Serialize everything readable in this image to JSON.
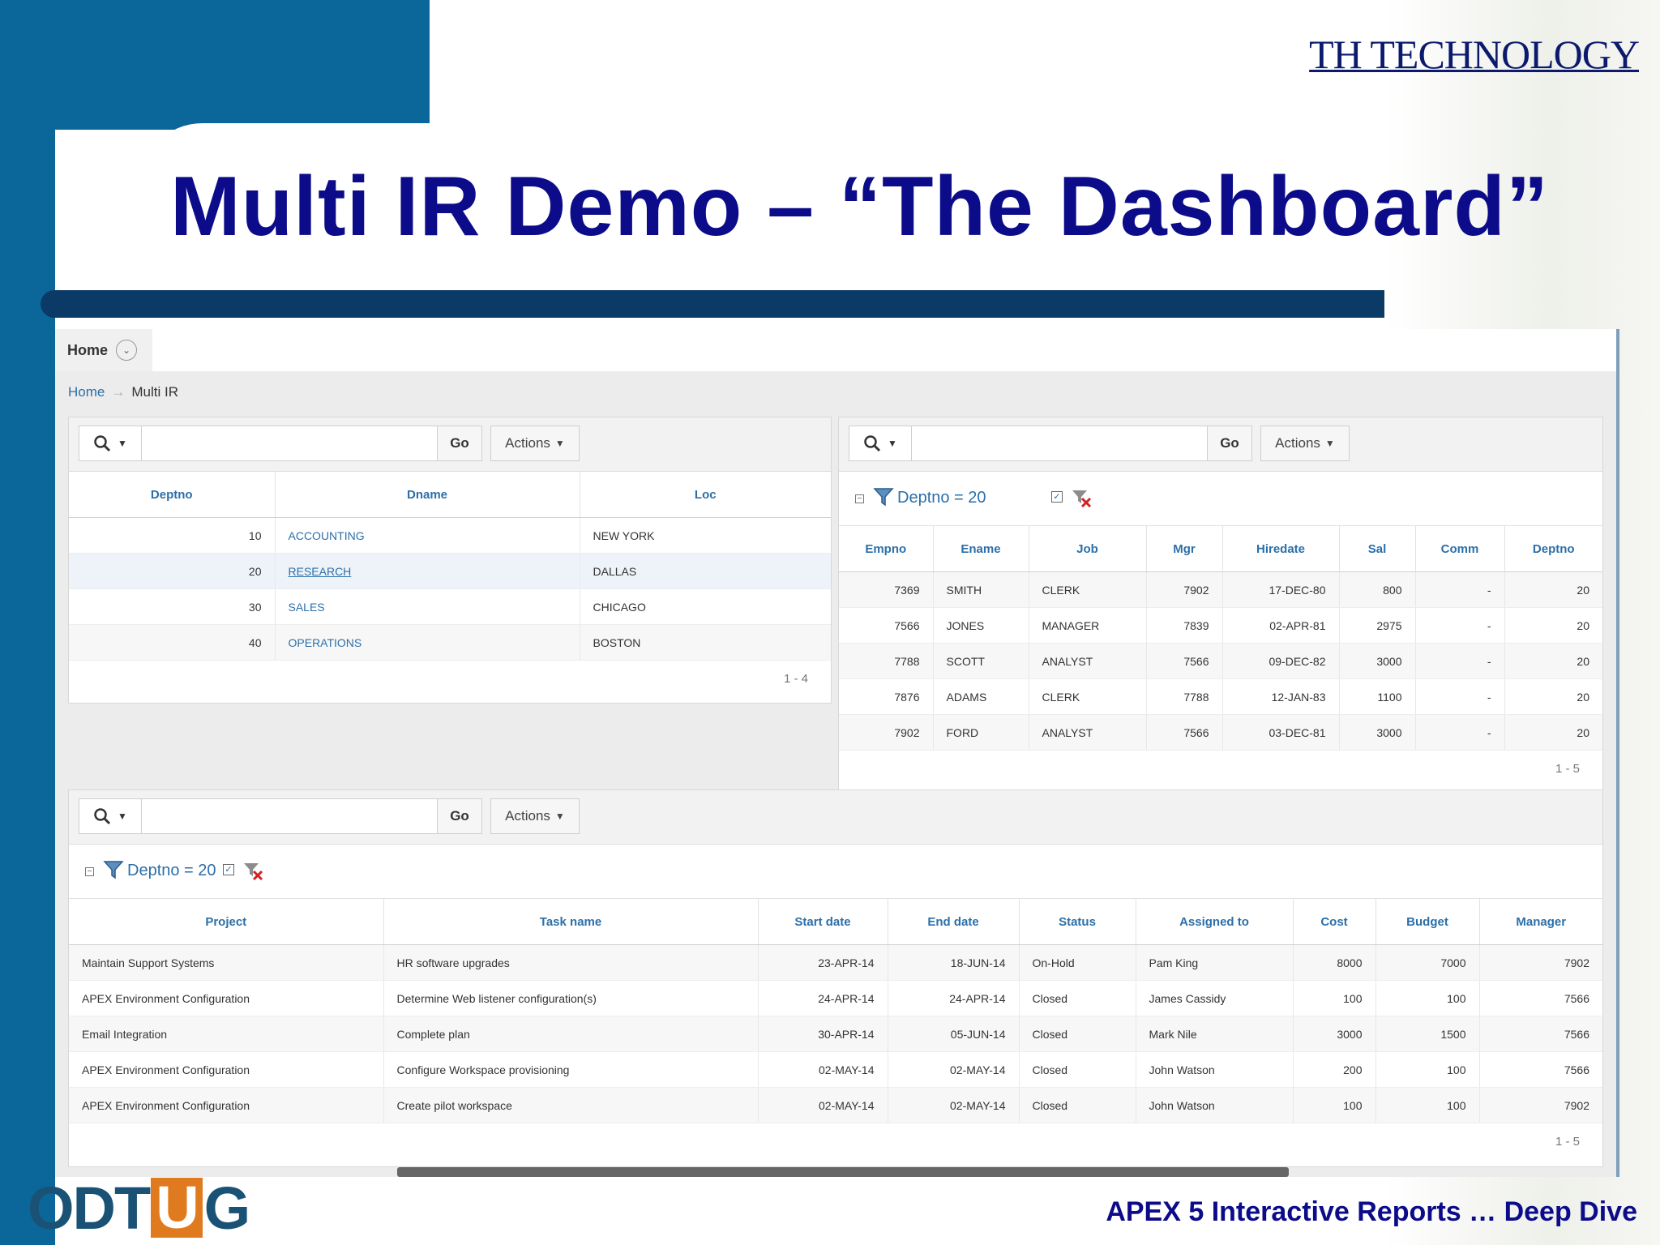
{
  "slide": {
    "brand": "TH TECHNOLOGY",
    "title": "Multi IR Demo – “The Dashboard”",
    "logo": {
      "part1": "ODT",
      "part2": "U",
      "part3": "G"
    },
    "footer": "APEX 5 Interactive Reports … Deep Dive"
  },
  "app": {
    "home_tab": "Home",
    "breadcrumb": {
      "home": "Home",
      "arrow": "→",
      "current": "Multi IR"
    }
  },
  "toolbar": {
    "go_label": "Go",
    "actions_label": "Actions",
    "search_placeholder": "",
    "search_value": ""
  },
  "dept_report": {
    "columns": [
      "Deptno",
      "Dname",
      "Loc"
    ],
    "rows": [
      [
        "10",
        "ACCOUNTING",
        "NEW YORK"
      ],
      [
        "20",
        "RESEARCH",
        "DALLAS"
      ],
      [
        "30",
        "SALES",
        "CHICAGO"
      ],
      [
        "40",
        "OPERATIONS",
        "BOSTON"
      ]
    ],
    "pagination": "1 - 4"
  },
  "emp_report": {
    "filter_label": "Deptno = 20",
    "columns": [
      "Empno",
      "Ename",
      "Job",
      "Mgr",
      "Hiredate",
      "Sal",
      "Comm",
      "Deptno"
    ],
    "rows": [
      [
        "7369",
        "SMITH",
        "CLERK",
        "7902",
        "17-DEC-80",
        "800",
        "-",
        "20"
      ],
      [
        "7566",
        "JONES",
        "MANAGER",
        "7839",
        "02-APR-81",
        "2975",
        "-",
        "20"
      ],
      [
        "7788",
        "SCOTT",
        "ANALYST",
        "7566",
        "09-DEC-82",
        "3000",
        "-",
        "20"
      ],
      [
        "7876",
        "ADAMS",
        "CLERK",
        "7788",
        "12-JAN-83",
        "1100",
        "-",
        "20"
      ],
      [
        "7902",
        "FORD",
        "ANALYST",
        "7566",
        "03-DEC-81",
        "3000",
        "-",
        "20"
      ]
    ],
    "pagination": "1 - 5"
  },
  "task_report": {
    "filter_label": "Deptno = 20",
    "columns": [
      "Project",
      "Task name",
      "Start date",
      "End date",
      "Status",
      "Assigned to",
      "Cost",
      "Budget",
      "Manager"
    ],
    "rows": [
      [
        "Maintain Support Systems",
        "HR software upgrades",
        "23-APR-14",
        "18-JUN-14",
        "On-Hold",
        "Pam King",
        "8000",
        "7000",
        "7902"
      ],
      [
        "APEX Environment Configuration",
        "Determine Web listener configuration(s)",
        "24-APR-14",
        "24-APR-14",
        "Closed",
        "James Cassidy",
        "100",
        "100",
        "7566"
      ],
      [
        "Email Integration",
        "Complete plan",
        "30-APR-14",
        "05-JUN-14",
        "Closed",
        "Mark Nile",
        "3000",
        "1500",
        "7566"
      ],
      [
        "APEX Environment Configuration",
        "Configure Workspace provisioning",
        "02-MAY-14",
        "02-MAY-14",
        "Closed",
        "John Watson",
        "200",
        "100",
        "7566"
      ],
      [
        "APEX Environment Configuration",
        "Create pilot workspace",
        "02-MAY-14",
        "02-MAY-14",
        "Closed",
        "John Watson",
        "100",
        "100",
        "7902"
      ]
    ],
    "pagination": "1 - 5"
  }
}
